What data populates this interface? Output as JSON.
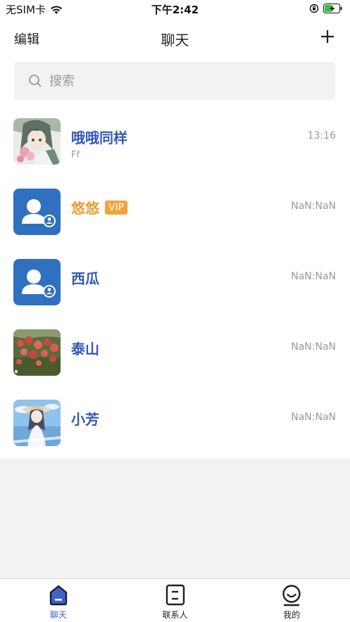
{
  "status_bar": {
    "carrier": "无SIM卡",
    "time": "下午2:42"
  },
  "nav": {
    "edit_label": "编辑",
    "title": "聊天"
  },
  "search": {
    "placeholder": "搜索"
  },
  "chats": [
    {
      "name": "哦哦同样",
      "preview": "Ff",
      "time": "13:16",
      "vip": false,
      "avatar": "anime-girl-flowers"
    },
    {
      "name": "悠悠",
      "preview": "",
      "time": "NaN:NaN",
      "vip": true,
      "vip_label": "VIP",
      "avatar": "default-user-icon"
    },
    {
      "name": "西瓜",
      "preview": "",
      "time": "NaN:NaN",
      "vip": false,
      "avatar": "default-user-icon"
    },
    {
      "name": "泰山",
      "preview": "",
      "time": "NaN:NaN",
      "vip": false,
      "avatar": "red-flowers-photo"
    },
    {
      "name": "小芳",
      "preview": "",
      "time": "NaN:NaN",
      "vip": false,
      "avatar": "anime-girl-sky"
    }
  ],
  "tabs": [
    {
      "label": "聊天",
      "icon": "chat-home-icon",
      "active": true
    },
    {
      "label": "联系人",
      "icon": "contacts-icon",
      "active": false
    },
    {
      "label": "我的",
      "icon": "profile-smile-icon",
      "active": false
    }
  ],
  "colors": {
    "name_blue": "#3558b8",
    "vip_orange": "#f2a33a",
    "tab_active": "#3f63c6"
  }
}
